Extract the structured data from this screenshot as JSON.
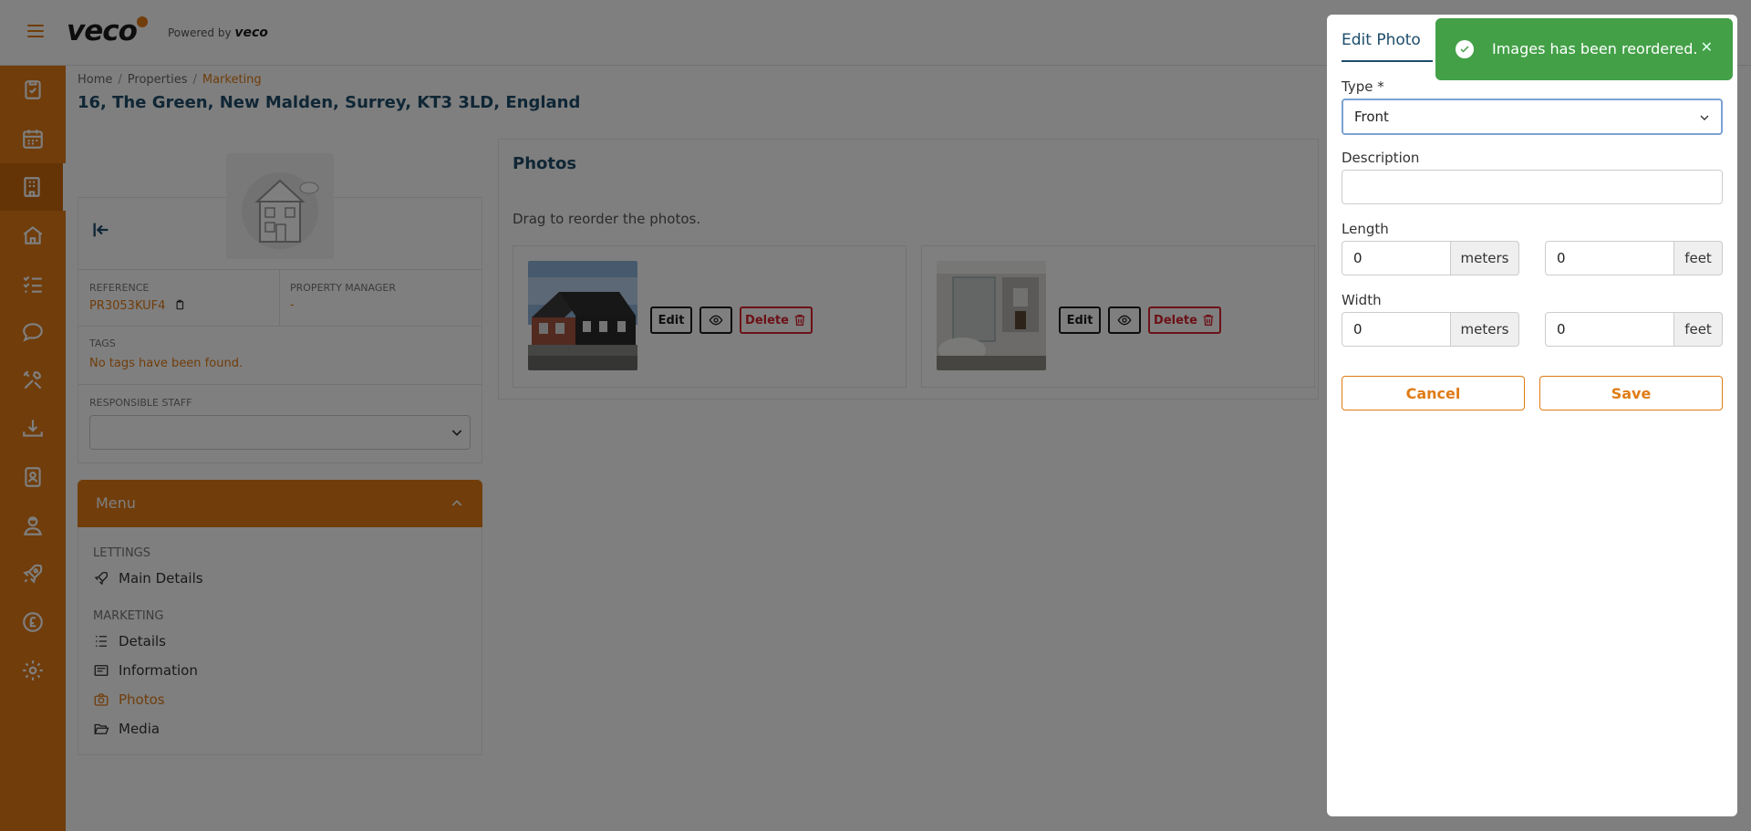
{
  "app": {
    "logo_text": "veco",
    "powered_by_prefix": "Powered by",
    "powered_by_brand": "veco"
  },
  "breadcrumb": {
    "home": "Home",
    "properties": "Properties",
    "current": "Marketing"
  },
  "page_title": "16, The Green, New Malden, Surrey, KT3 3LD, England",
  "property": {
    "reference_label": "Reference",
    "reference_value": "PR3053KUF4",
    "manager_label": "Property Manager",
    "manager_value": "-",
    "tags_label": "Tags",
    "tags_value": "No tags have been found.",
    "responsible_label": "Responsible Staff",
    "responsible_value": ""
  },
  "menu": {
    "title": "Menu",
    "section_lettings": "Lettings",
    "item_main_details": "Main Details",
    "section_marketing": "Marketing",
    "item_details": "Details",
    "item_information": "Information",
    "item_photos": "Photos",
    "item_media": "Media"
  },
  "photos": {
    "title": "Photos",
    "hint": "Drag to reorder the photos.",
    "edit_label": "Edit",
    "delete_label": "Delete"
  },
  "edit_panel": {
    "title": "Edit Photo",
    "type_label": "Type *",
    "type_value": "Front",
    "description_label": "Description",
    "description_value": "",
    "length_label": "Length",
    "length_meters": "0",
    "length_feet": "0",
    "width_label": "Width",
    "width_meters": "0",
    "width_feet": "0",
    "unit_meters": "meters",
    "unit_feet": "feet",
    "cancel_label": "Cancel",
    "save_label": "Save"
  },
  "toast": {
    "message": "Images has been reordered.",
    "close": "✕"
  },
  "colors": {
    "brand": "#e07b16",
    "title": "#1e4d6b",
    "success": "#43a047",
    "danger": "#d9232d"
  }
}
